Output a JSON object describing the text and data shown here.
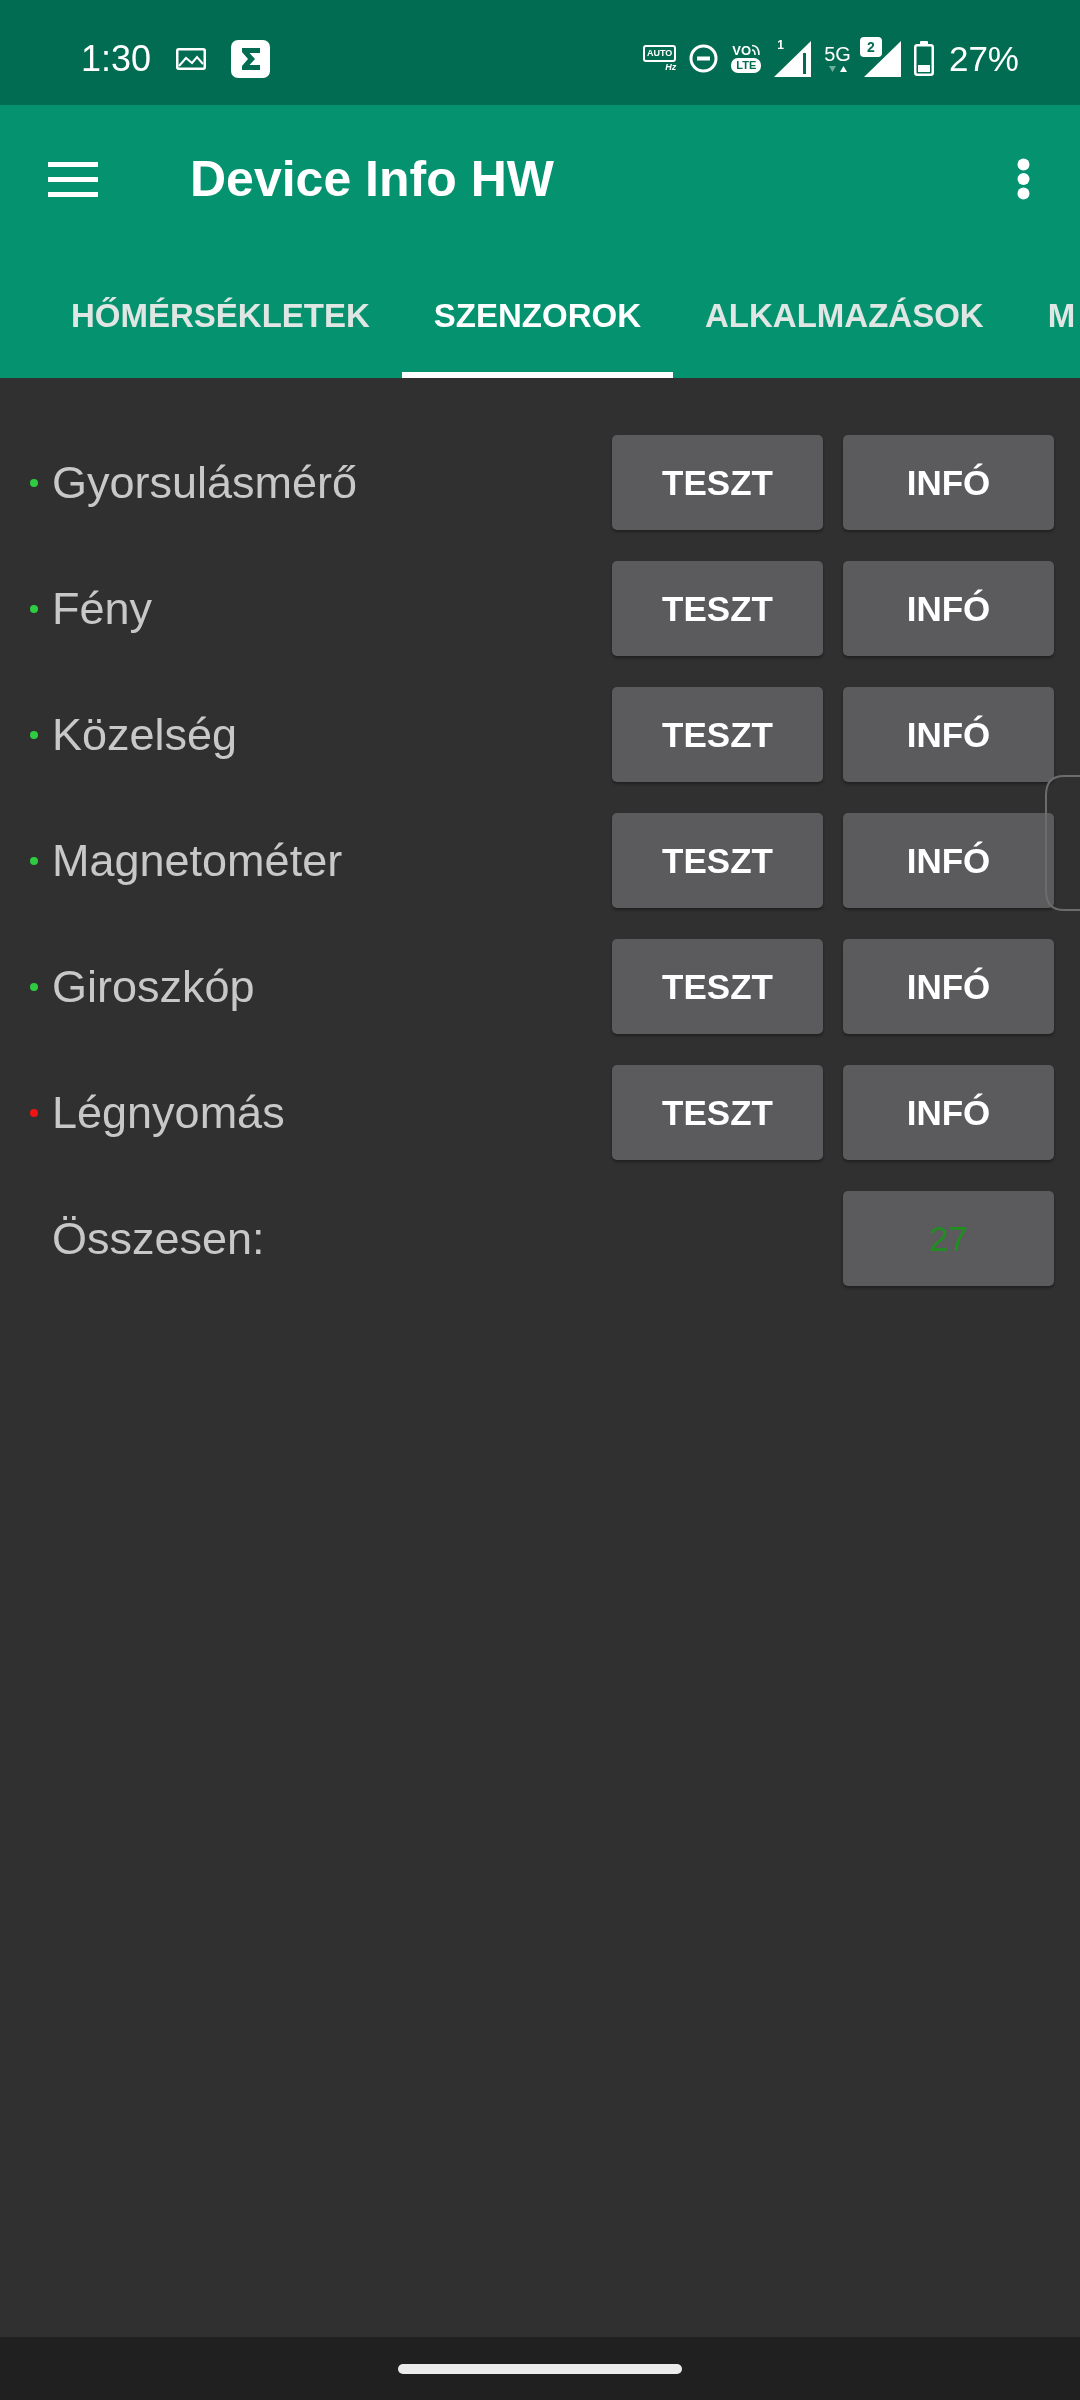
{
  "status_bar": {
    "time": "1:30",
    "refresh_rate": {
      "top": "AUTO",
      "bottom": "Hz"
    },
    "volte": {
      "top": "VO",
      "bottom": "LTE"
    },
    "sim1": "1",
    "network": "5G",
    "sim2": "2",
    "battery": "27%"
  },
  "app_bar": {
    "title": "Device Info HW"
  },
  "tabs": [
    {
      "label": "HŐMÉRSÉKLETEK",
      "selected": false
    },
    {
      "label": "SZENZOROK",
      "selected": true
    },
    {
      "label": "ALKALMAZÁSOK",
      "selected": false
    },
    {
      "label": "M",
      "selected": false
    }
  ],
  "sensors": [
    {
      "name": "Gyorsulásmérő",
      "color": "#2ecc40",
      "buttons": [
        "TESZT",
        "INFÓ"
      ]
    },
    {
      "name": "Fény",
      "color": "#2ecc40",
      "buttons": [
        "TESZT",
        "INFÓ"
      ]
    },
    {
      "name": "Közelség",
      "color": "#2ecc40",
      "buttons": [
        "TESZT",
        "INFÓ"
      ]
    },
    {
      "name": "Magnetométer",
      "color": "#2ecc40",
      "buttons": [
        "TESZT",
        "INFÓ"
      ]
    },
    {
      "name": "Giroszkóp",
      "color": "#2ecc40",
      "buttons": [
        "TESZT",
        "INFÓ"
      ]
    },
    {
      "name": "Légnyomás",
      "color": "#f01414",
      "buttons": [
        "TESZT",
        "INFÓ"
      ]
    }
  ],
  "total": {
    "label": "Összesen:",
    "value": "27"
  }
}
